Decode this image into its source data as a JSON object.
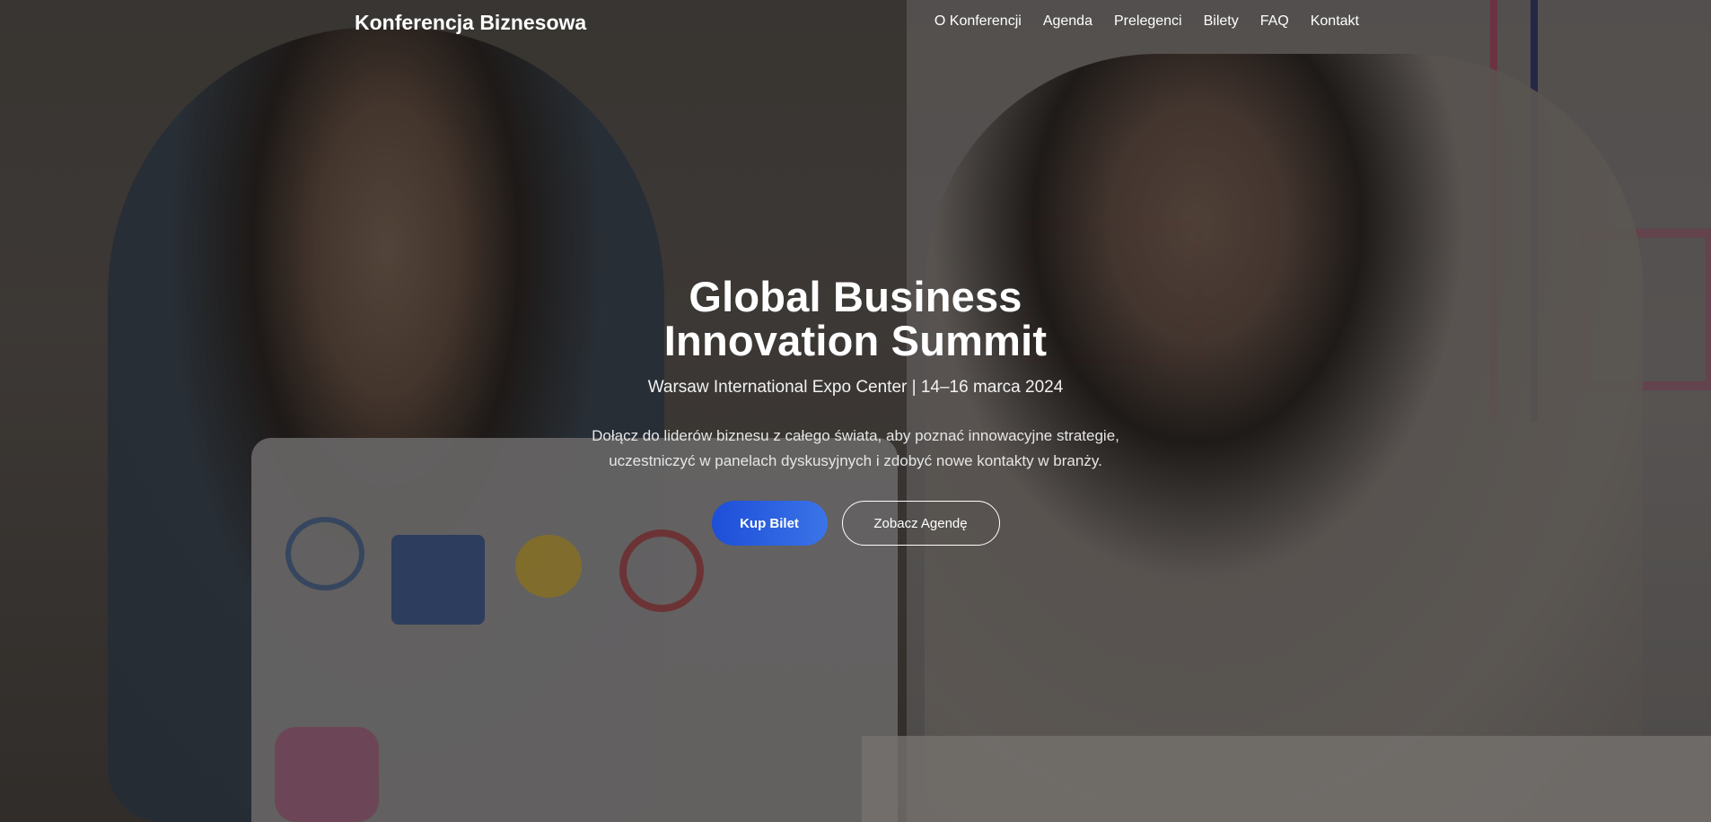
{
  "navbar": {
    "brand": "Konferencja Biznesowa",
    "links": [
      "O Konferencji",
      "Agenda",
      "Prelegenci",
      "Bilety",
      "FAQ",
      "Kontakt"
    ]
  },
  "hero": {
    "title_line1": "Global Business",
    "title_line2": "Innovation Summit",
    "subtitle": "Warsaw International Expo Center | 14–16 marca 2024",
    "description_line1": "Dołącz do liderów biznesu z całego świata, aby poznać innowacyjne strategie,",
    "description_line2": "uczestniczyć w panelach dyskusyjnych i zdobyć nowe kontakty w branży.",
    "primary_cta": "Kup Bilet",
    "secondary_cta": "Zobacz Agendę"
  },
  "colors": {
    "primary_button": "#1d4ed8",
    "overlay": "rgba(0,0,0,0.38)",
    "text": "#ffffff"
  }
}
